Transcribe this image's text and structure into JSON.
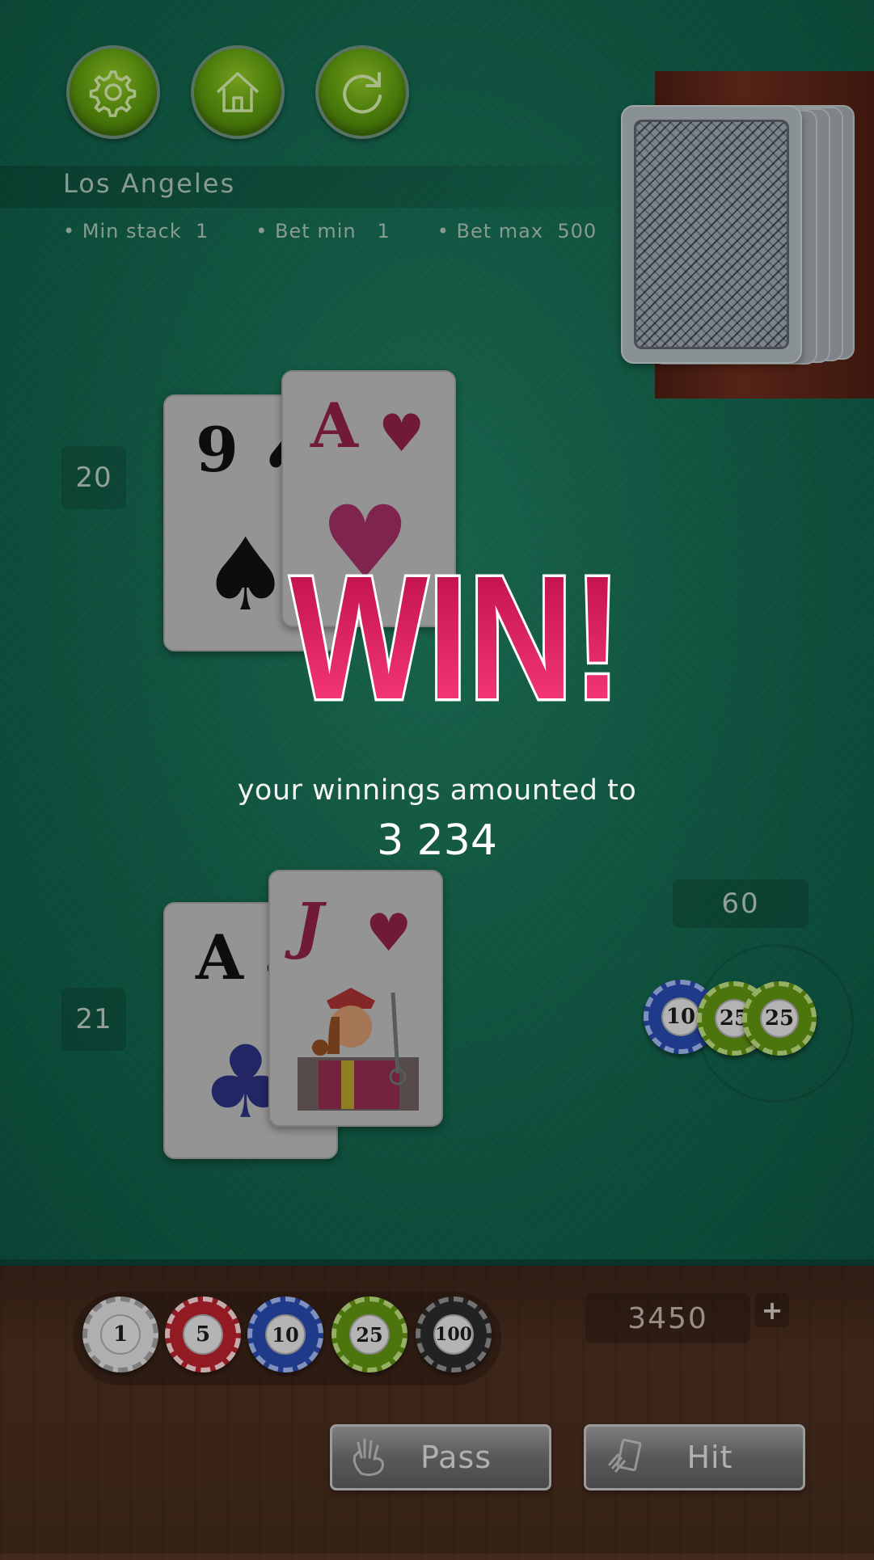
{
  "table": {
    "city": "Los Angeles",
    "limits": [
      {
        "label": "• Min stack",
        "value": "1"
      },
      {
        "label": "• Bet min",
        "value": "1"
      },
      {
        "label": "• Bet max",
        "value": "500"
      }
    ]
  },
  "toolbar": {
    "settings_icon": "gear-icon",
    "home_icon": "home-icon",
    "restart_icon": "refresh-icon"
  },
  "dealer": {
    "score": "20",
    "cards": [
      {
        "rank": "9",
        "suit": "♠",
        "color": "#111111"
      },
      {
        "rank": "A",
        "suit": "♥",
        "color": "#8a1f45"
      }
    ]
  },
  "player": {
    "score": "21",
    "cards": [
      {
        "rank": "A",
        "suit": "♣",
        "color": "#111111"
      },
      {
        "rank": "J",
        "suit": "♥",
        "color": "#8a1f45"
      }
    ],
    "bet": "60",
    "bet_chips": [
      "10",
      "25",
      "25"
    ]
  },
  "result": {
    "title": "WIN!",
    "message": "your winnings amounted to",
    "amount": "3 234"
  },
  "chip_tray": [
    {
      "value": "1",
      "color": "#d6d6d6"
    },
    {
      "value": "5",
      "color": "#b3202a"
    },
    {
      "value": "10",
      "color": "#2747a8"
    },
    {
      "value": "25",
      "color": "#5f8f12"
    },
    {
      "value": "100",
      "color": "#2a2a2a"
    }
  ],
  "balance": "3450",
  "add_funds_label": "+",
  "actions": {
    "pass_label": "Pass",
    "hit_label": "Hit"
  }
}
